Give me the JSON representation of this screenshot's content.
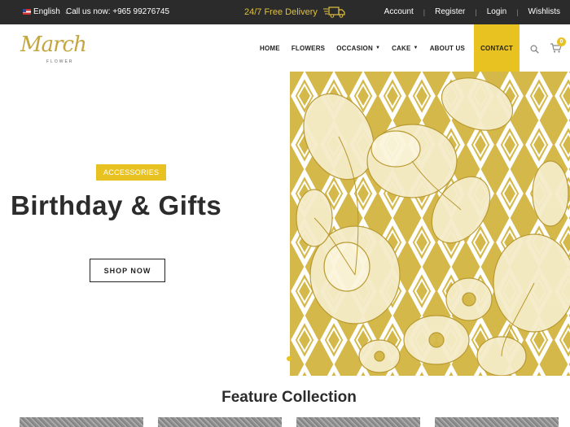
{
  "topbar": {
    "language": "English",
    "phone": "Call us now: +965 99276745",
    "delivery": "24/7 Free Delivery",
    "links": [
      "Account",
      "Register",
      "Login",
      "Wishlists"
    ]
  },
  "logo": {
    "script": "March",
    "sub": "FLOWER"
  },
  "nav": {
    "items": [
      {
        "label": "HOME"
      },
      {
        "label": "FLOWERS"
      },
      {
        "label": "OCCASION"
      },
      {
        "label": "CAKE"
      },
      {
        "label": "ABOUT US"
      },
      {
        "label": "CONTACT"
      }
    ]
  },
  "cart": {
    "count": "0"
  },
  "hero": {
    "badge": "ACCESSORIES",
    "title": "Birthday & Gifts",
    "button": "SHOP NOW"
  },
  "feature": {
    "title": "Feature Collection"
  },
  "colors": {
    "accent": "#e8c220",
    "topbar": "#2b2b2b",
    "delivery": "#e0c23e"
  }
}
